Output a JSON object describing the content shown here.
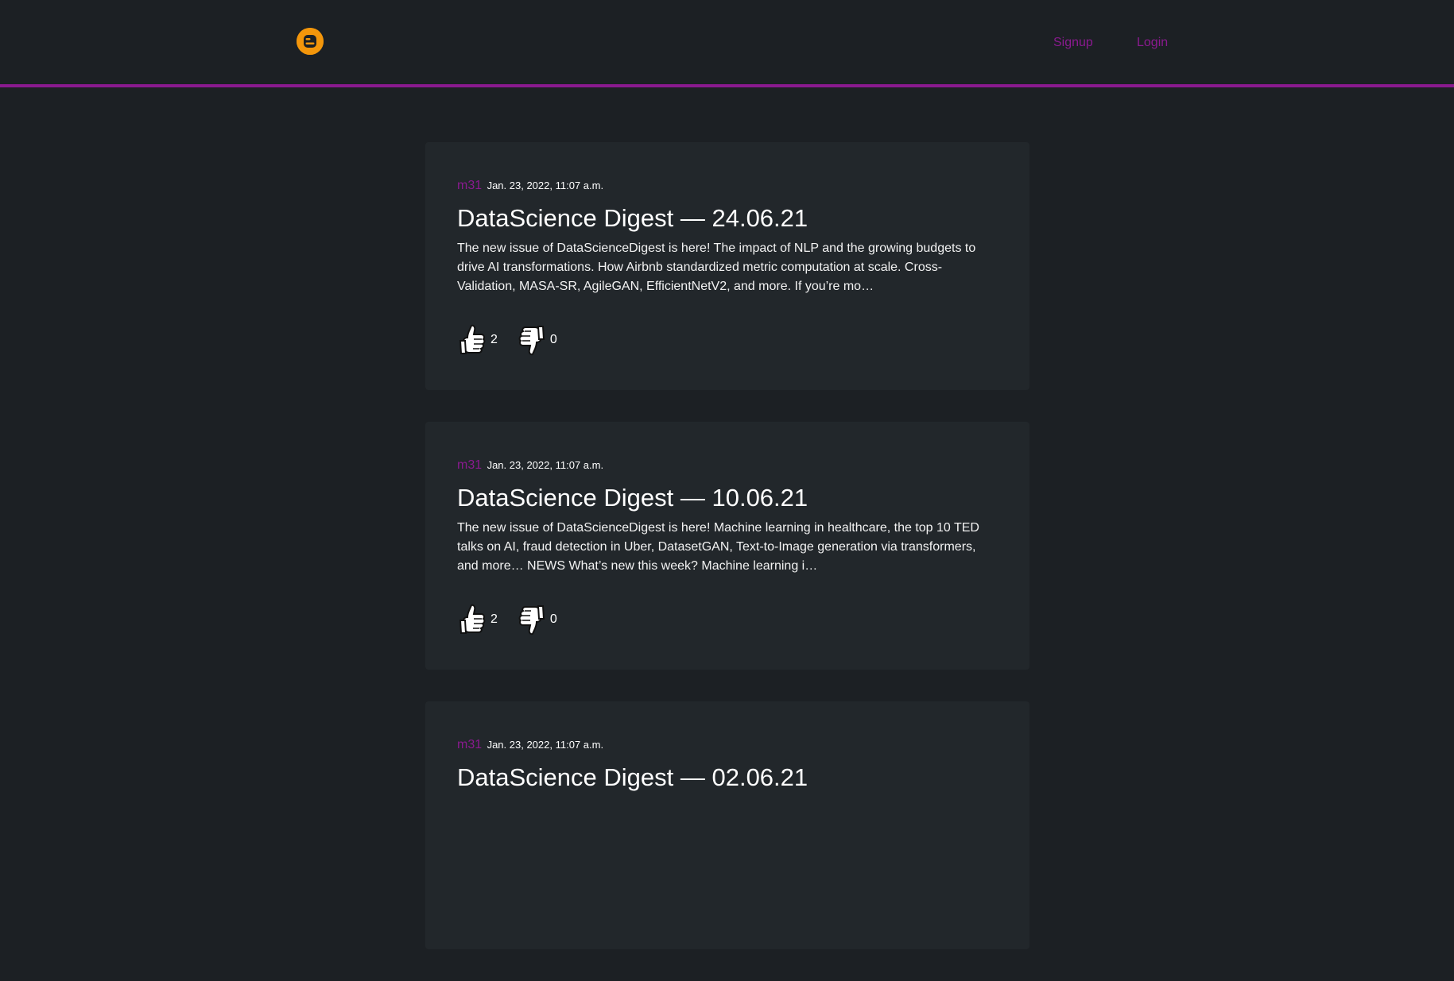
{
  "nav": {
    "logo_icon": "blogger-logo-icon",
    "signup_label": "Signup",
    "login_label": "Login",
    "accent_color": "#8a1a8f",
    "logo_color": "#f3960b"
  },
  "posts": [
    {
      "author": "m31",
      "date": "Jan. 23, 2022, 11:07 a.m.",
      "title": "DataScience Digest — 24.06.21",
      "excerpt": "The new issue of DataScienceDigest is here! The impact of NLP and the growing budgets to drive AI transformations. How Airbnb standardized metric computation at scale. Cross-Validation, MASA-SR, AgileGAN, EfficientNetV2, and more. If you’re mo…",
      "likes": "2",
      "dislikes": "0"
    },
    {
      "author": "m31",
      "date": "Jan. 23, 2022, 11:07 a.m.",
      "title": "DataScience Digest — 10.06.21",
      "excerpt": "The new issue of DataScienceDigest is here! Machine learning in healthcare, the top 10 TED talks on AI, fraud detection in Uber, DatasetGAN, Text-to-Image generation via transformers, and more… NEWS What’s new this week? Machine learning i…",
      "likes": "2",
      "dislikes": "0"
    },
    {
      "author": "m31",
      "date": "Jan. 23, 2022, 11:07 a.m.",
      "title": "DataScience Digest — 02.06.21",
      "excerpt": "",
      "likes": "",
      "dislikes": ""
    }
  ]
}
